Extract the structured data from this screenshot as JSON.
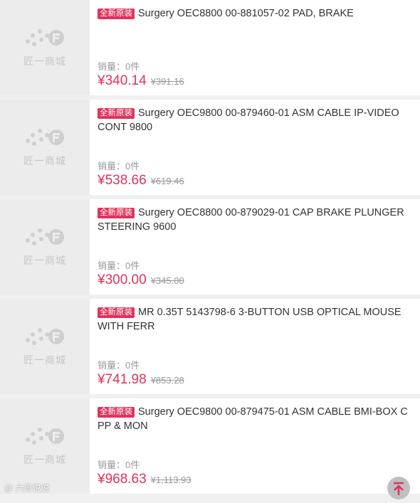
{
  "thumb_logo_text": "匠一商城",
  "sales_prefix": "销量：",
  "products": [
    {
      "tag": "全新原装",
      "title": "Surgery OEC8800 00-881057-02 PAD, BRAKE",
      "sales": "0件",
      "price": "¥340.14",
      "original_price": "¥391.16"
    },
    {
      "tag": "全新原装",
      "title": "Surgery OEC9800 00-879460-01 ASM CABLE IP-VIDEO CONT 9800",
      "sales": "0件",
      "price": "¥538.66",
      "original_price": "¥619.46"
    },
    {
      "tag": "全新原装",
      "title": "Surgery OEC8800 00-879029-01 CAP BRAKE PLUNGER STEERING 9600",
      "sales": "0件",
      "price": "¥300.00",
      "original_price": "¥345.00"
    },
    {
      "tag": "全新原装",
      "title": "MR 0.35T 5143798-6 3-BUTTON USB OPTICAL MOUSE WITH FERR",
      "sales": "0件",
      "price": "¥741.98",
      "original_price": "¥853.28"
    },
    {
      "tag": "全新原装",
      "title": "Surgery OEC9800 00-879475-01 ASM CABLE BMI-BOX C PP & MON",
      "sales": "0件",
      "price": "¥968.63",
      "original_price": "¥1,113.93"
    }
  ],
  "watermark_text": "@ 六郎说说",
  "back_to_top_icon": "arrow-up-to-top-icon",
  "colors": {
    "accent": "#e0325a",
    "muted": "#999999"
  }
}
